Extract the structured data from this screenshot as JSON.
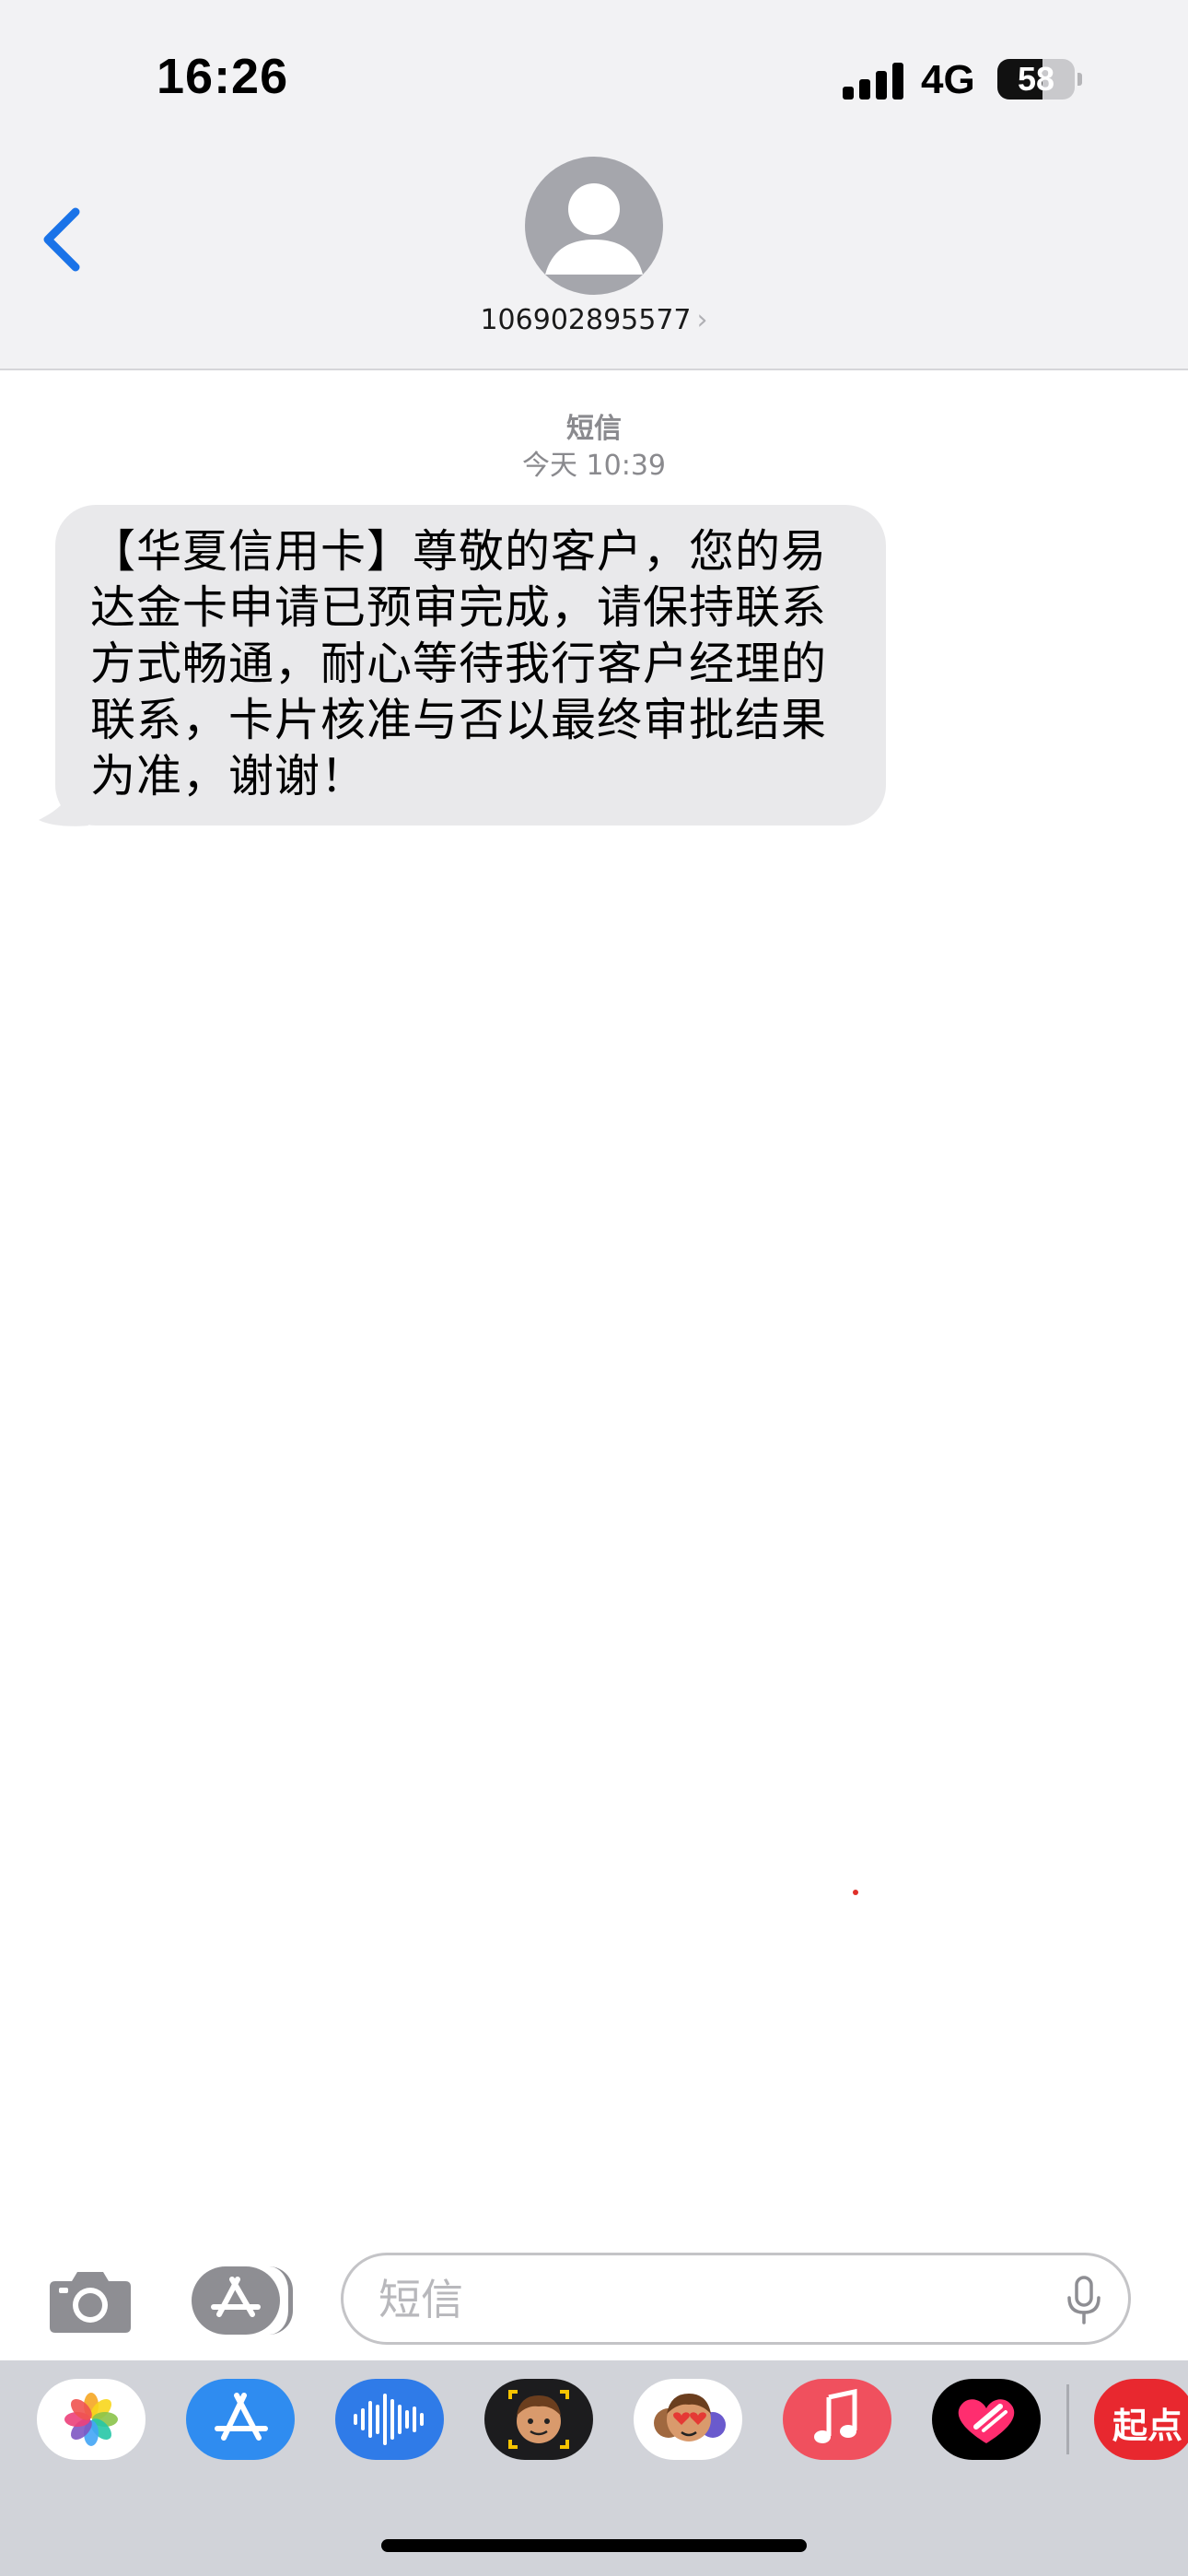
{
  "status_bar": {
    "time": "16:26",
    "network": "4G",
    "battery_percent": "58",
    "battery_level": 0.58
  },
  "header": {
    "contact": "106902895577",
    "back_icon": "chevron-left-icon",
    "avatar_icon": "person-placeholder-icon"
  },
  "conversation": {
    "service_label": "短信",
    "timestamp": "今天 10:39",
    "messages": [
      {
        "direction": "incoming",
        "lines": [
          "【华夏信用卡】尊敬的客户，您的易",
          "达金卡申请已预审完成，请保持联系",
          "方式畅通，耐心等待我行客户经理的",
          "联系，卡片核准与否以最终审批结果",
          "为准，谢谢！"
        ]
      }
    ]
  },
  "compose": {
    "placeholder": "短信",
    "camera_icon": "camera-icon",
    "apps_icon": "app-store-icon",
    "mic_icon": "microphone-icon"
  },
  "app_drawer": {
    "apps": [
      {
        "name": "photos-app-icon"
      },
      {
        "name": "app-store-app-icon"
      },
      {
        "name": "audio-message-app-icon"
      },
      {
        "name": "memoji-camera-app-icon"
      },
      {
        "name": "memoji-stickers-app-icon"
      },
      {
        "name": "music-app-icon"
      },
      {
        "name": "digital-touch-app-icon"
      },
      {
        "name": "qidian-app-icon",
        "label": "起点"
      }
    ]
  },
  "colors": {
    "ios_blue": "#1a73e8",
    "bubble_gray": "#e9e9eb",
    "header_bg": "#f2f2f4",
    "drawer_bg": "#d1d3d9"
  }
}
